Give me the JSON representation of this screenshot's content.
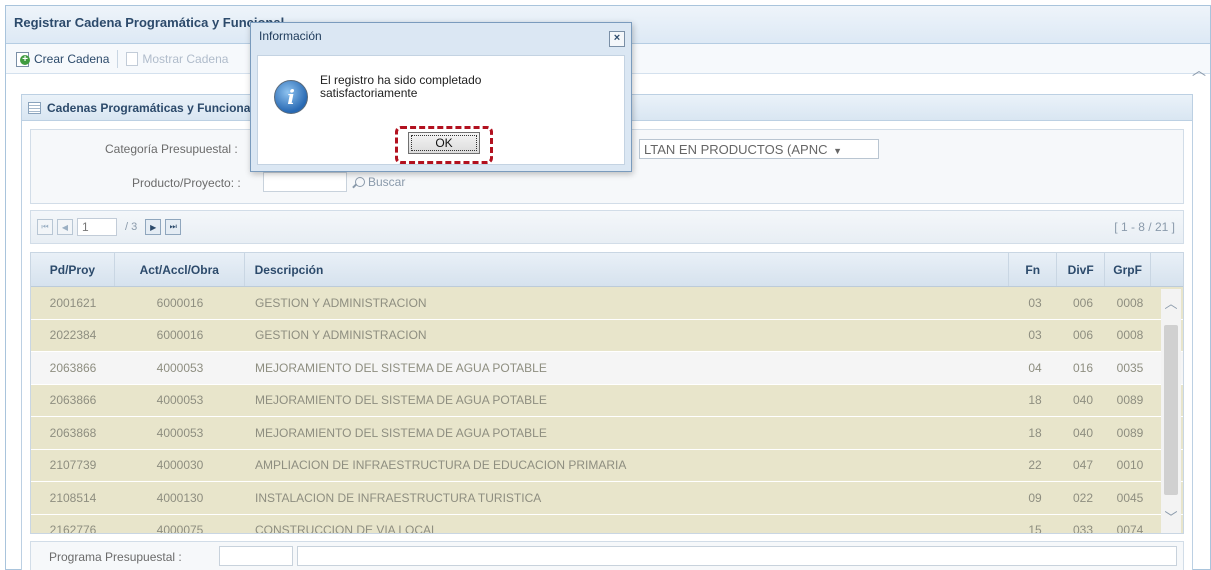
{
  "window": {
    "title": "Registrar Cadena Programática y Funcional"
  },
  "toolbar": {
    "create_label": "Crear Cadena",
    "show_label": "Mostrar Cadena"
  },
  "panel": {
    "title": "Cadenas Programáticas y Funcionales"
  },
  "filters": {
    "categoria_label": "Categoría Presupuestal :",
    "categoria_value_visible": "LTAN EN PRODUCTOS (APNC",
    "producto_label": "Producto/Proyecto: :",
    "search_label": "Buscar"
  },
  "pager": {
    "page": "1",
    "total": "/ 3",
    "range": "[ 1 - 8 / 21 ]"
  },
  "grid": {
    "headers": [
      "Pd/Proy",
      "Act/Accl/Obra",
      "Descripción",
      "Fn",
      "DivF",
      "GrpF"
    ],
    "rows": [
      [
        "2001621",
        "6000016",
        "GESTION Y ADMINISTRACION",
        "03",
        "006",
        "0008"
      ],
      [
        "2022384",
        "6000016",
        "GESTION Y ADMINISTRACION",
        "03",
        "006",
        "0008"
      ],
      [
        "2063866",
        "4000053",
        "MEJORAMIENTO DEL SISTEMA DE AGUA POTABLE",
        "04",
        "016",
        "0035"
      ],
      [
        "2063866",
        "4000053",
        "MEJORAMIENTO DEL SISTEMA DE AGUA POTABLE",
        "18",
        "040",
        "0089"
      ],
      [
        "2063868",
        "4000053",
        "MEJORAMIENTO DEL SISTEMA DE AGUA POTABLE",
        "18",
        "040",
        "0089"
      ],
      [
        "2107739",
        "4000030",
        "AMPLIACION DE INFRAESTRUCTURA DE EDUCACION PRIMARIA",
        "22",
        "047",
        "0010"
      ],
      [
        "2108514",
        "4000130",
        "INSTALACION DE INFRAESTRUCTURA TURISTICA",
        "09",
        "022",
        "0045"
      ],
      [
        "2162776",
        "4000075",
        "CONSTRUCCION DE VIA LOCAL",
        "15",
        "033",
        "0074"
      ]
    ]
  },
  "bottom": {
    "programa_label": "Programa Presupuestal :"
  },
  "dialog": {
    "title": "Información",
    "message_line1": "El registro ha sido completado",
    "message_line2": "satisfactoriamente",
    "ok_label": "OK",
    "close_label": "×",
    "info_glyph": "i"
  },
  "colors": {
    "highlight_dashes": "#b2111f",
    "row_tan": "#e8e5cb",
    "header_text": "#2c4a6b"
  }
}
